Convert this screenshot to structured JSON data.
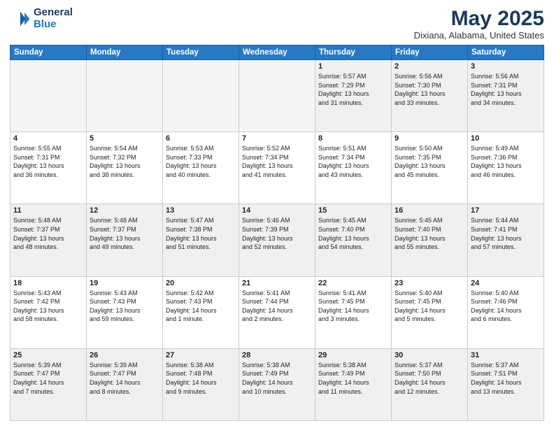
{
  "logo": {
    "general": "General",
    "blue": "Blue"
  },
  "title": "May 2025",
  "location": "Dixiana, Alabama, United States",
  "headers": [
    "Sunday",
    "Monday",
    "Tuesday",
    "Wednesday",
    "Thursday",
    "Friday",
    "Saturday"
  ],
  "weeks": [
    [
      {
        "day": "",
        "text": ""
      },
      {
        "day": "",
        "text": ""
      },
      {
        "day": "",
        "text": ""
      },
      {
        "day": "",
        "text": ""
      },
      {
        "day": "1",
        "text": "Sunrise: 5:57 AM\nSunset: 7:29 PM\nDaylight: 13 hours\nand 31 minutes."
      },
      {
        "day": "2",
        "text": "Sunrise: 5:56 AM\nSunset: 7:30 PM\nDaylight: 13 hours\nand 33 minutes."
      },
      {
        "day": "3",
        "text": "Sunrise: 5:56 AM\nSunset: 7:31 PM\nDaylight: 13 hours\nand 34 minutes."
      }
    ],
    [
      {
        "day": "4",
        "text": "Sunrise: 5:55 AM\nSunset: 7:31 PM\nDaylight: 13 hours\nand 36 minutes."
      },
      {
        "day": "5",
        "text": "Sunrise: 5:54 AM\nSunset: 7:32 PM\nDaylight: 13 hours\nand 38 minutes."
      },
      {
        "day": "6",
        "text": "Sunrise: 5:53 AM\nSunset: 7:33 PM\nDaylight: 13 hours\nand 40 minutes."
      },
      {
        "day": "7",
        "text": "Sunrise: 5:52 AM\nSunset: 7:34 PM\nDaylight: 13 hours\nand 41 minutes."
      },
      {
        "day": "8",
        "text": "Sunrise: 5:51 AM\nSunset: 7:34 PM\nDaylight: 13 hours\nand 43 minutes."
      },
      {
        "day": "9",
        "text": "Sunrise: 5:50 AM\nSunset: 7:35 PM\nDaylight: 13 hours\nand 45 minutes."
      },
      {
        "day": "10",
        "text": "Sunrise: 5:49 AM\nSunset: 7:36 PM\nDaylight: 13 hours\nand 46 minutes."
      }
    ],
    [
      {
        "day": "11",
        "text": "Sunrise: 5:48 AM\nSunset: 7:37 PM\nDaylight: 13 hours\nand 48 minutes."
      },
      {
        "day": "12",
        "text": "Sunrise: 5:48 AM\nSunset: 7:37 PM\nDaylight: 13 hours\nand 49 minutes."
      },
      {
        "day": "13",
        "text": "Sunrise: 5:47 AM\nSunset: 7:38 PM\nDaylight: 13 hours\nand 51 minutes."
      },
      {
        "day": "14",
        "text": "Sunrise: 5:46 AM\nSunset: 7:39 PM\nDaylight: 13 hours\nand 52 minutes."
      },
      {
        "day": "15",
        "text": "Sunrise: 5:45 AM\nSunset: 7:40 PM\nDaylight: 13 hours\nand 54 minutes."
      },
      {
        "day": "16",
        "text": "Sunrise: 5:45 AM\nSunset: 7:40 PM\nDaylight: 13 hours\nand 55 minutes."
      },
      {
        "day": "17",
        "text": "Sunrise: 5:44 AM\nSunset: 7:41 PM\nDaylight: 13 hours\nand 57 minutes."
      }
    ],
    [
      {
        "day": "18",
        "text": "Sunrise: 5:43 AM\nSunset: 7:42 PM\nDaylight: 13 hours\nand 58 minutes."
      },
      {
        "day": "19",
        "text": "Sunrise: 5:43 AM\nSunset: 7:43 PM\nDaylight: 13 hours\nand 59 minutes."
      },
      {
        "day": "20",
        "text": "Sunrise: 5:42 AM\nSunset: 7:43 PM\nDaylight: 14 hours\nand 1 minute."
      },
      {
        "day": "21",
        "text": "Sunrise: 5:41 AM\nSunset: 7:44 PM\nDaylight: 14 hours\nand 2 minutes."
      },
      {
        "day": "22",
        "text": "Sunrise: 5:41 AM\nSunset: 7:45 PM\nDaylight: 14 hours\nand 3 minutes."
      },
      {
        "day": "23",
        "text": "Sunrise: 5:40 AM\nSunset: 7:45 PM\nDaylight: 14 hours\nand 5 minutes."
      },
      {
        "day": "24",
        "text": "Sunrise: 5:40 AM\nSunset: 7:46 PM\nDaylight: 14 hours\nand 6 minutes."
      }
    ],
    [
      {
        "day": "25",
        "text": "Sunrise: 5:39 AM\nSunset: 7:47 PM\nDaylight: 14 hours\nand 7 minutes."
      },
      {
        "day": "26",
        "text": "Sunrise: 5:39 AM\nSunset: 7:47 PM\nDaylight: 14 hours\nand 8 minutes."
      },
      {
        "day": "27",
        "text": "Sunrise: 5:38 AM\nSunset: 7:48 PM\nDaylight: 14 hours\nand 9 minutes."
      },
      {
        "day": "28",
        "text": "Sunrise: 5:38 AM\nSunset: 7:49 PM\nDaylight: 14 hours\nand 10 minutes."
      },
      {
        "day": "29",
        "text": "Sunrise: 5:38 AM\nSunset: 7:49 PM\nDaylight: 14 hours\nand 11 minutes."
      },
      {
        "day": "30",
        "text": "Sunrise: 5:37 AM\nSunset: 7:50 PM\nDaylight: 14 hours\nand 12 minutes."
      },
      {
        "day": "31",
        "text": "Sunrise: 5:37 AM\nSunset: 7:51 PM\nDaylight: 14 hours\nand 13 minutes."
      }
    ]
  ]
}
